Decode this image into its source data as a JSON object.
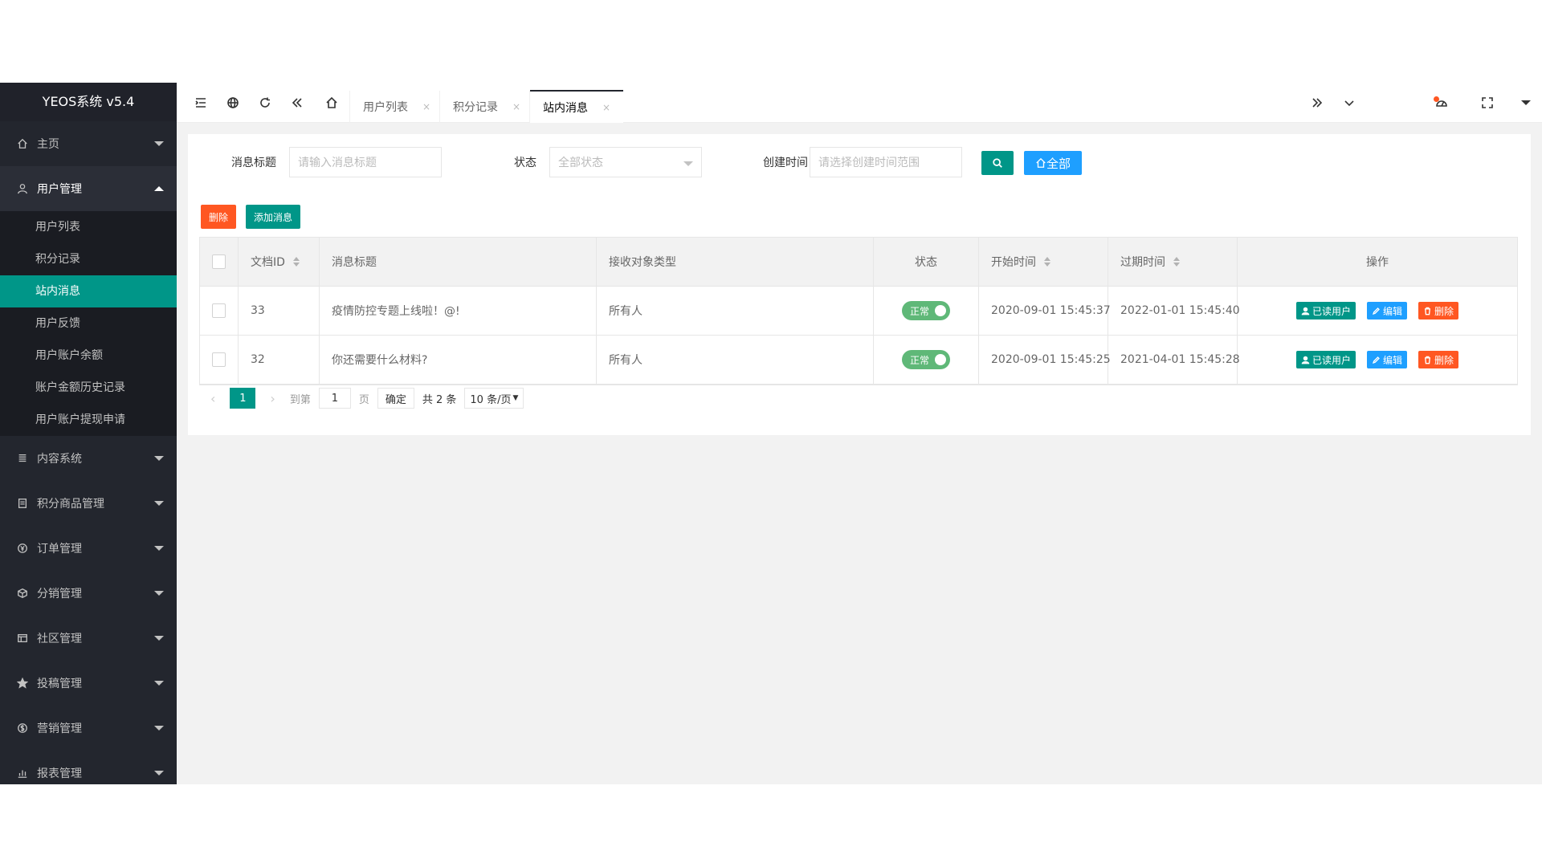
{
  "app_title": "YEOS系统 v5.4",
  "sidebar": {
    "menus": [
      {
        "label": "主页",
        "icon": "home-icon",
        "open": false
      },
      {
        "label": "用户管理",
        "icon": "user-icon",
        "open": true,
        "children": [
          "用户列表",
          "积分记录",
          "站内消息",
          "用户反馈",
          "用户账户余额",
          "账户金额历史记录",
          "用户账户提现申请"
        ],
        "active_child": 2
      },
      {
        "label": "内容系统",
        "icon": "content-icon",
        "open": false
      },
      {
        "label": "积分商品管理",
        "icon": "goods-icon",
        "open": false
      },
      {
        "label": "订单管理",
        "icon": "yen-icon",
        "open": false
      },
      {
        "label": "分销管理",
        "icon": "cube-icon",
        "open": false
      },
      {
        "label": "社区管理",
        "icon": "community-icon",
        "open": false
      },
      {
        "label": "投稿管理",
        "icon": "star-icon",
        "open": false
      },
      {
        "label": "营销管理",
        "icon": "dollar-icon",
        "open": false
      },
      {
        "label": "报表管理",
        "icon": "chart-icon",
        "open": false
      }
    ]
  },
  "header": {
    "tabs": [
      {
        "label": "用户列表",
        "close": "×"
      },
      {
        "label": "积分记录",
        "close": "×"
      },
      {
        "label": "站内消息",
        "close": "×",
        "active": true
      }
    ]
  },
  "search": {
    "title_label": "消息标题",
    "title_placeholder": "请输入消息标题",
    "status_label": "状态",
    "status_value": "全部状态",
    "time_label": "创建时间",
    "time_placeholder": "请选择创建时间范围",
    "all_button": "全部"
  },
  "toolbar": {
    "delete_label": "删除",
    "add_label": "添加消息"
  },
  "table": {
    "columns": [
      "文档ID",
      "消息标题",
      "接收对象类型",
      "状态",
      "开始时间",
      "过期时间",
      "操作"
    ],
    "rows": [
      {
        "id": "33",
        "title": "疫情防控专题上线啦！@!",
        "target": "所有人",
        "status": "正常",
        "start": "2020-09-01 15:45:37",
        "expire": "2022-01-01 15:45:40"
      },
      {
        "id": "32",
        "title": "你还需要什么材料?",
        "target": "所有人",
        "status": "正常",
        "start": "2020-09-01 15:45:25",
        "expire": "2021-04-01 15:45:28"
      }
    ],
    "op_read_users": "已读用户",
    "op_edit": "编辑",
    "op_delete": "删除"
  },
  "pager": {
    "current": "1",
    "goto_label": "到第",
    "goto_value": "1",
    "page_unit": "页",
    "confirm": "确定",
    "total": "共 2 条",
    "page_size": "10 条/页"
  },
  "colors": {
    "sidebar_bg": "#23262e",
    "accent_green": "#009688",
    "blue": "#1e9fff",
    "orange": "#ff5722",
    "switch_green": "#5fb878"
  }
}
